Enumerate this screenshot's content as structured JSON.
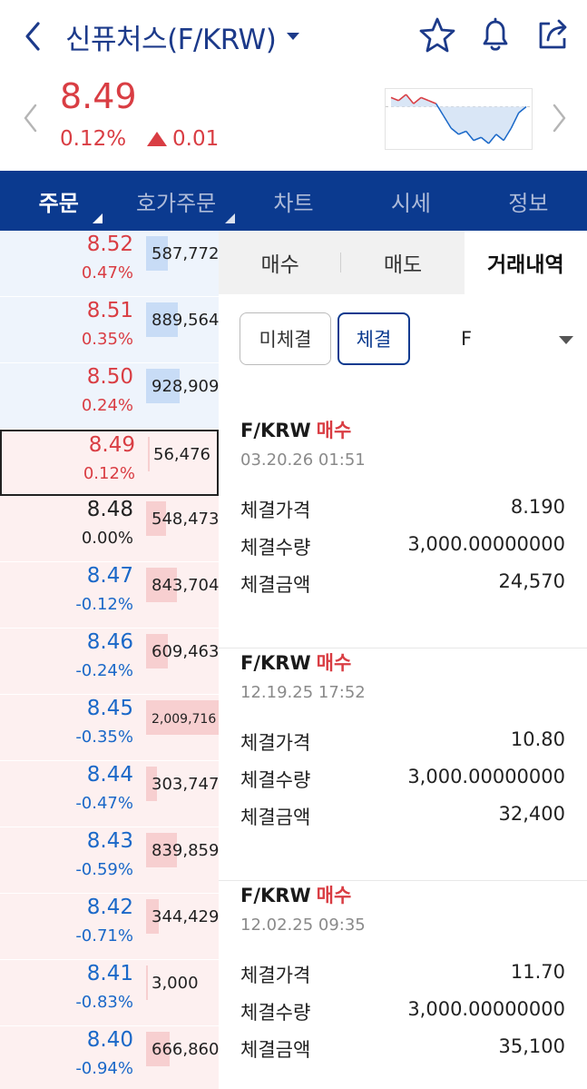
{
  "header": {
    "title": "신퓨처스(F/KRW)",
    "icons": [
      "back-icon",
      "star-icon",
      "bell-icon",
      "share-icon"
    ]
  },
  "summary": {
    "price": "8.49",
    "change_pct": "0.12%",
    "change_abs": "0.01",
    "direction": "up",
    "color_up": "#d93d43",
    "mini_chart_series": [
      8.52,
      8.51,
      8.53,
      8.5,
      8.52,
      8.51,
      8.5,
      8.46,
      8.42,
      8.4,
      8.41,
      8.38,
      8.39,
      8.37,
      8.4,
      8.38,
      8.42,
      8.47,
      8.49
    ]
  },
  "tabs": [
    {
      "label": "주문",
      "active": true
    },
    {
      "label": "호가주문",
      "active": false
    },
    {
      "label": "차트",
      "active": false
    },
    {
      "label": "시세",
      "active": false
    },
    {
      "label": "정보",
      "active": false
    }
  ],
  "orderbook": {
    "rows": [
      {
        "price": "8.52",
        "pct": "0.47%",
        "qty": "587,772",
        "side": "ask",
        "color": "red",
        "fill": 0.3
      },
      {
        "price": "8.51",
        "pct": "0.35%",
        "qty": "889,564",
        "side": "ask",
        "color": "red",
        "fill": 0.44
      },
      {
        "price": "8.50",
        "pct": "0.24%",
        "qty": "928,909",
        "side": "ask",
        "color": "red",
        "fill": 0.46
      },
      {
        "price": "8.49",
        "pct": "0.12%",
        "qty": "56,476",
        "side": "bid",
        "color": "red",
        "fill": 0.03,
        "current": true
      },
      {
        "price": "8.48",
        "pct": "0.00%",
        "qty": "548,473",
        "side": "bid",
        "color": "black",
        "fill": 0.27
      },
      {
        "price": "8.47",
        "pct": "-0.12%",
        "qty": "843,704",
        "side": "bid",
        "color": "blue",
        "fill": 0.42
      },
      {
        "price": "8.46",
        "pct": "-0.24%",
        "qty": "609,463",
        "side": "bid",
        "color": "blue",
        "fill": 0.3
      },
      {
        "price": "8.45",
        "pct": "-0.35%",
        "qty": "2,009,716",
        "side": "bid",
        "color": "blue",
        "fill": 1.0
      },
      {
        "price": "8.44",
        "pct": "-0.47%",
        "qty": "303,747",
        "side": "bid",
        "color": "blue",
        "fill": 0.15
      },
      {
        "price": "8.43",
        "pct": "-0.59%",
        "qty": "839,859",
        "side": "bid",
        "color": "blue",
        "fill": 0.42
      },
      {
        "price": "8.42",
        "pct": "-0.71%",
        "qty": "344,429",
        "side": "bid",
        "color": "blue",
        "fill": 0.17
      },
      {
        "price": "8.41",
        "pct": "-0.83%",
        "qty": "3,000",
        "side": "bid",
        "color": "blue",
        "fill": 0.01
      },
      {
        "price": "8.40",
        "pct": "-0.94%",
        "qty": "666,860",
        "side": "bid",
        "color": "blue",
        "fill": 0.33
      }
    ]
  },
  "panel": {
    "segments": [
      "매수",
      "매도",
      "거래내역"
    ],
    "active_segment": "거래내역",
    "filter_unfilled": "미체결",
    "filter_filled": "체결",
    "filter_select": "F",
    "trades": [
      {
        "pair": "F/KRW",
        "side": "매수",
        "date": "03.20.26 01:51",
        "price_label": "체결가격",
        "price": "8.190",
        "qty_label": "체결수량",
        "qty": "3,000.00000000",
        "amount_label": "체결금액",
        "amount": "24,570"
      },
      {
        "pair": "F/KRW",
        "side": "매수",
        "date": "12.19.25 17:52",
        "price_label": "체결가격",
        "price": "10.80",
        "qty_label": "체결수량",
        "qty": "3,000.00000000",
        "amount_label": "체결금액",
        "amount": "32,400"
      },
      {
        "pair": "F/KRW",
        "side": "매수",
        "date": "12.02.25 09:35",
        "price_label": "체결가격",
        "price": "11.70",
        "qty_label": "체결수량",
        "qty": "3,000.00000000",
        "amount_label": "체결금액",
        "amount": "35,100"
      }
    ]
  }
}
